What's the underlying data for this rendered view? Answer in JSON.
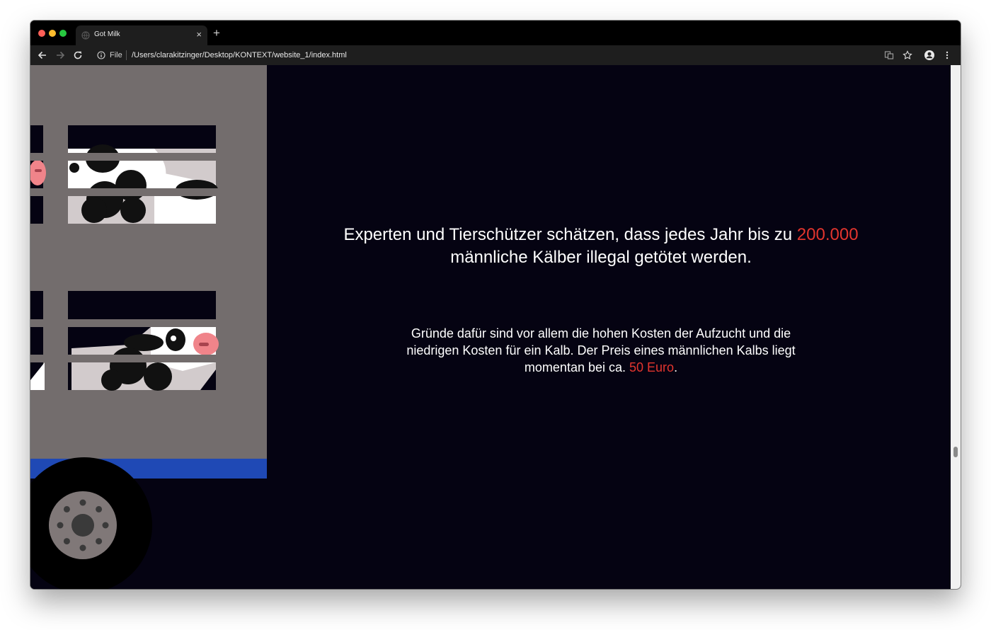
{
  "browser": {
    "tab_title": "Got Milk",
    "url_scheme": "File",
    "url_path": "/Users/clarakitzinger/Desktop/KONTEXT/website_1/index.html"
  },
  "content": {
    "headline_part1": "Experten und Tierschützer schätzen, dass jedes Jahr bis zu",
    "headline_highlight": "200.000",
    "headline_part2": "männliche Kälber illegal getötet werden.",
    "body_part1": "Gründe dafür sind vor allem die hohen Kosten der Aufzucht und die niedrigen Kosten für ein Kalb. Der Preis eines männlichen Kalbs liegt momentan bei ca.",
    "body_highlight": "50 Euro",
    "body_part2": "."
  },
  "colors": {
    "page_background": "#050312",
    "accent": "#e2352e",
    "truck_body": "#736d6d",
    "truck_stripe": "#1f49b5",
    "calf_white": "#ffffff",
    "calf_pink": "#f0848a"
  },
  "icons": [
    "back-arrow-icon",
    "forward-arrow-icon",
    "reload-icon",
    "info-icon",
    "translate-icon",
    "star-icon",
    "profile-icon",
    "menu-dots-icon",
    "close-icon",
    "new-tab-icon"
  ]
}
